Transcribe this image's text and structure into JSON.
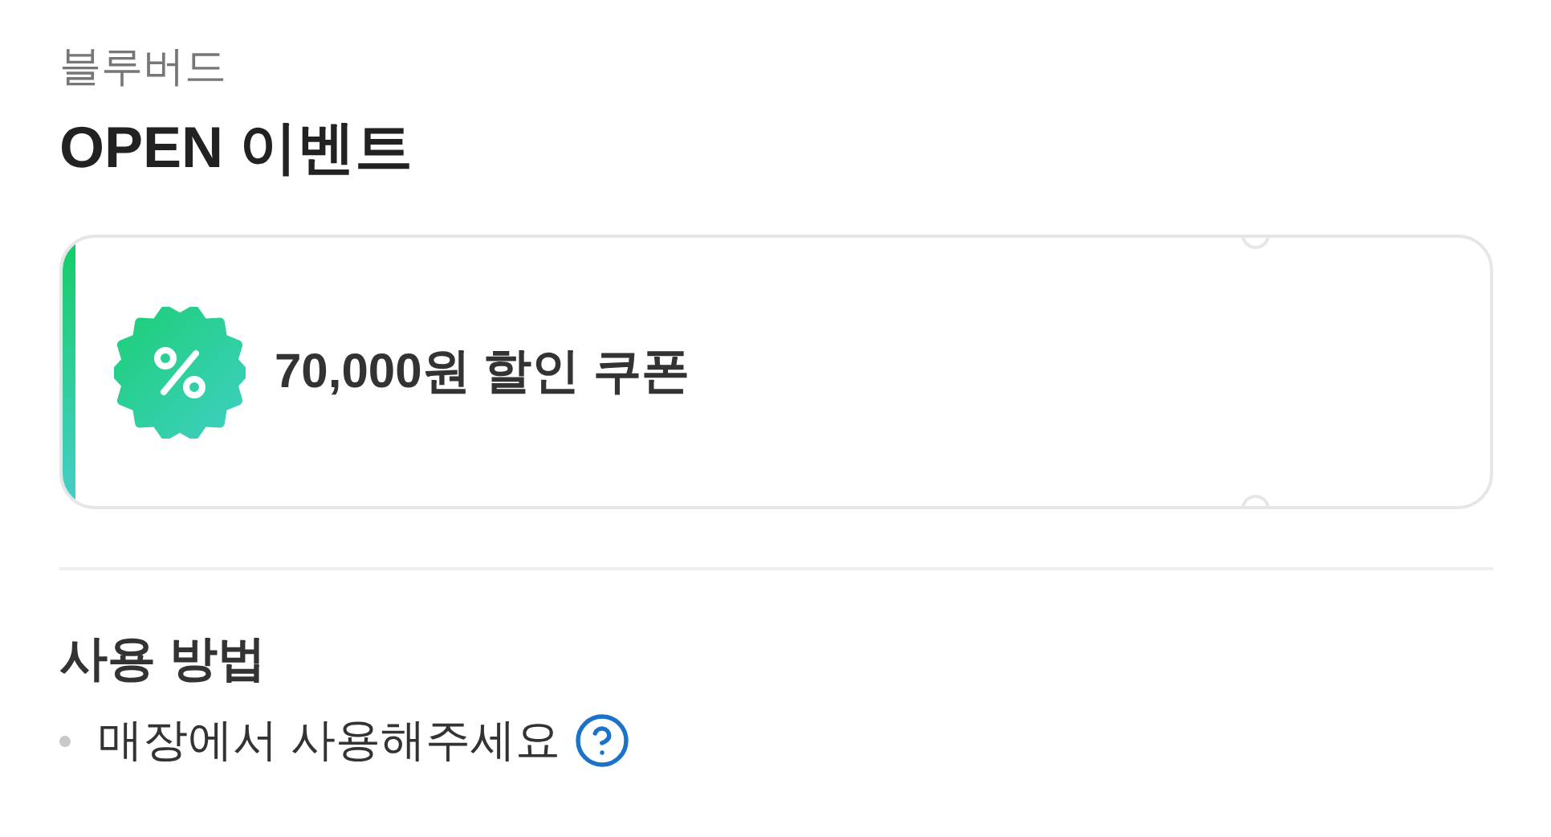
{
  "brand": "블루버드",
  "title": "OPEN 이벤트",
  "coupon": {
    "label": "70,000원 할인 쿠폰"
  },
  "usage": {
    "heading": "사용 방법",
    "items": [
      {
        "text": "매장에서 사용해주세요",
        "help": true
      }
    ]
  }
}
